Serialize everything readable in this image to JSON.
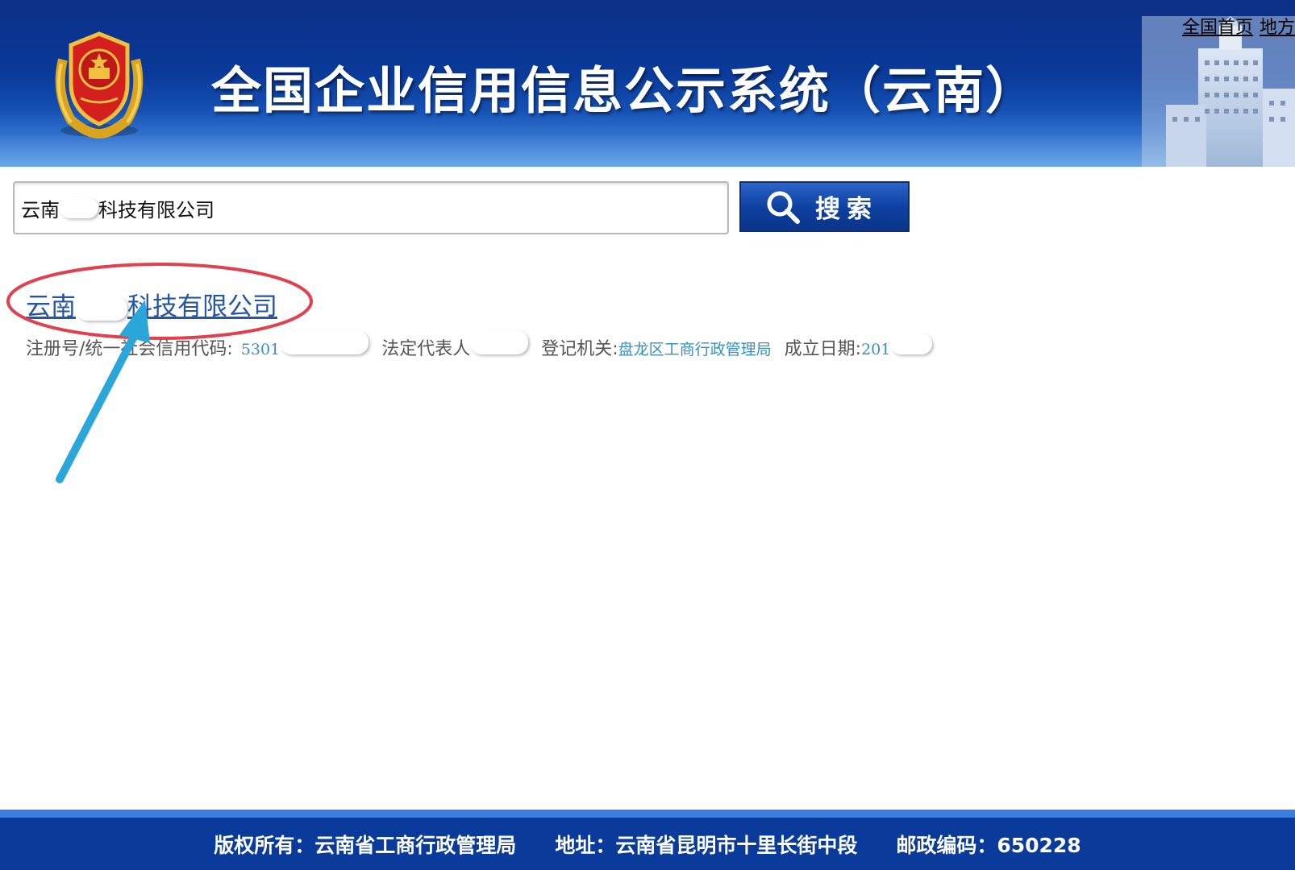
{
  "header": {
    "site_title": "全国企业信用信息公示系统（云南）",
    "top_links": [
      "全国首页",
      "地方"
    ]
  },
  "search": {
    "value_prefix": "云南",
    "value_suffix": "科技有限公司",
    "button_label": "搜索"
  },
  "result": {
    "title_prefix": "云南",
    "title_suffix": "科技有限公司",
    "reg_label": "注册号/统一社会信用代码:",
    "reg_value": "5301",
    "rep_label": "法定代表人",
    "authority_label": "登记机关:",
    "authority_value": "盘龙区工商行政管理局",
    "date_label": "成立日期:",
    "date_value": "201"
  },
  "footer": {
    "copyright": "版权所有：云南省工商行政管理局",
    "address": "地址：云南省昆明市十里长街中段",
    "postcode": "邮政编码：650228"
  },
  "colors": {
    "header_blue": "#0a3a9a",
    "link_blue": "#2455a6",
    "value_blue": "#3a8fbf",
    "annotation_red": "#e0404f",
    "annotation_arrow": "#2aa7d8"
  }
}
